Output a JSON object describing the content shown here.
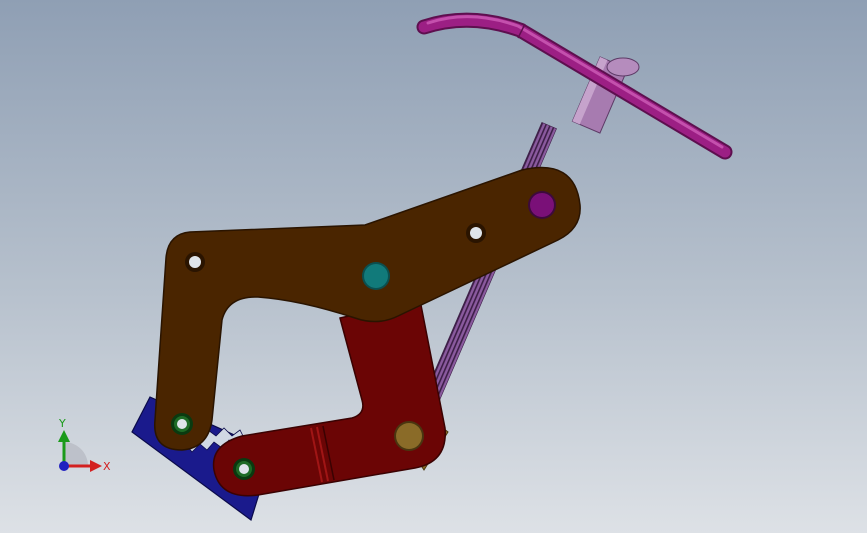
{
  "viewport": {
    "background_top": "#8f9fb4",
    "background_bottom": "#dde1e6"
  },
  "colors": {
    "upper_arm": "#4a2500",
    "lower_arm": "#6b0505",
    "lower_arm_edge": "#3a0202",
    "jaw_pad": "#1a1a8c",
    "screw": "#8a5a9e",
    "handle": "#9c1f84",
    "collar": "#a77bb0",
    "pin_teal": "#117a7a",
    "pin_purple": "#7a1078",
    "pin_bronze": "#8a6b28"
  },
  "triad": {
    "x_label": "X",
    "y_label": "Y",
    "x_color": "#d32020",
    "y_color": "#1a9a1a",
    "z_color": "#2020c0"
  }
}
